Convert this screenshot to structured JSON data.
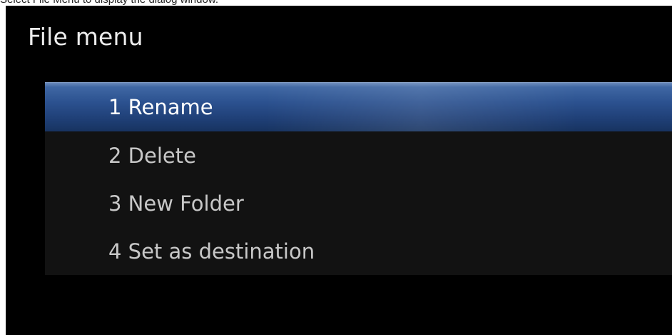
{
  "caption": "Select File Menu to display the dialog window.",
  "menu": {
    "title": "File menu",
    "selected_index": 0,
    "items": [
      {
        "label": "1 Rename"
      },
      {
        "label": "2 Delete"
      },
      {
        "label": "3 New Folder"
      },
      {
        "label": "4 Set as destination"
      }
    ]
  },
  "colors": {
    "screen_background": "#000000",
    "highlight": "#2c5290",
    "item_background": "#121212",
    "item_text": "#c8c8c8",
    "selected_text": "#ffffff",
    "title_text": "#ededed"
  }
}
